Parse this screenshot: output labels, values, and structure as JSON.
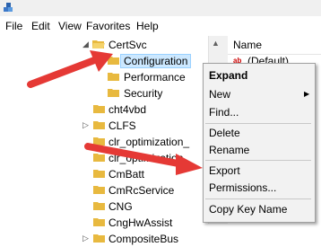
{
  "menubar": {
    "items": [
      "File",
      "Edit",
      "View",
      "Favorites",
      "Help"
    ]
  },
  "tree": {
    "items": [
      {
        "label": "CertSvc"
      },
      {
        "label": "Configuration"
      },
      {
        "label": "Performance"
      },
      {
        "label": "Security"
      },
      {
        "label": "cht4vbd"
      },
      {
        "label": "CLFS"
      },
      {
        "label": "clr_optimization_"
      },
      {
        "label": "clr_optimization_"
      },
      {
        "label": "CmBatt"
      },
      {
        "label": "CmRcService"
      },
      {
        "label": "CNG"
      },
      {
        "label": "CngHwAssist"
      },
      {
        "label": "CompositeBus"
      }
    ]
  },
  "values_pane": {
    "column_name": "Name",
    "value_icon": "ab",
    "first_value": "(Default)"
  },
  "context_menu": {
    "expand": "Expand",
    "new": "New",
    "find": "Find...",
    "delete": "Delete",
    "rename": "Rename",
    "export": "Export",
    "permissions": "Permissions...",
    "copy_key_name": "Copy Key Name",
    "submenu_arrow": "▶"
  },
  "colors": {
    "arrow": "#e53935",
    "selection": "#cce8ff",
    "folder": "#e8b93f"
  }
}
